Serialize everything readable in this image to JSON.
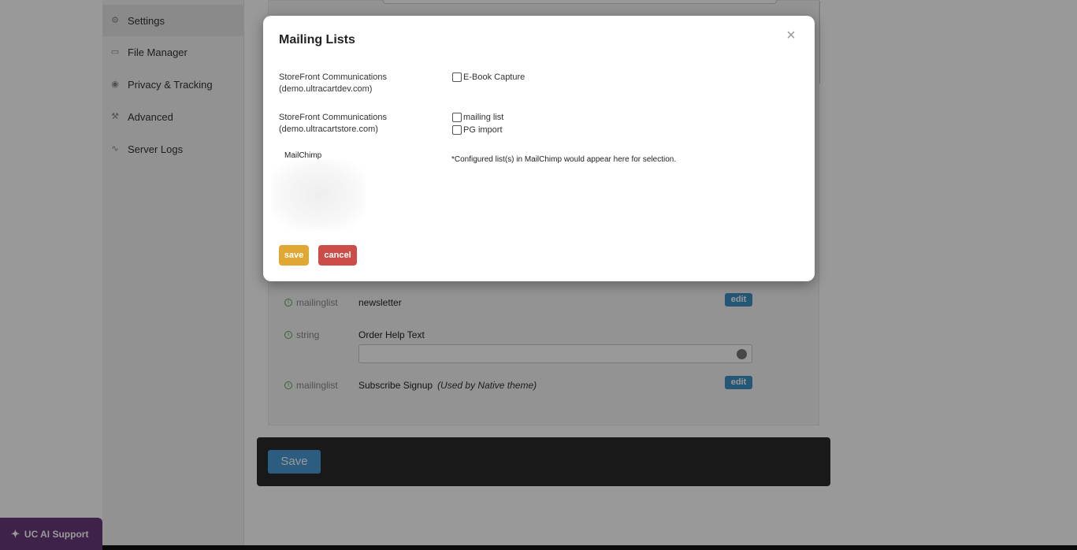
{
  "sidebar": {
    "items": [
      {
        "label": "Settings",
        "icon": "gear-icon",
        "active": true
      },
      {
        "label": "File Manager",
        "icon": "folder-icon",
        "active": false
      },
      {
        "label": "Privacy & Tracking",
        "icon": "eye-icon",
        "active": false
      },
      {
        "label": "Advanced",
        "icon": "wrench-icon",
        "active": false
      },
      {
        "label": "Server Logs",
        "icon": "pulse-icon",
        "active": false
      }
    ]
  },
  "main": {
    "rows": [
      {
        "type": "mailinglist",
        "label": "newsletter",
        "note": "",
        "edit": "edit"
      },
      {
        "type": "string",
        "label": "Order Help Text",
        "note": "",
        "edit": ""
      },
      {
        "type": "mailinglist",
        "label": "Subscribe Signup",
        "note": "(Used by Native theme)",
        "edit": "edit"
      }
    ],
    "save_label": "Save"
  },
  "ai_support": {
    "label": "UC AI Support"
  },
  "modal": {
    "title": "Mailing Lists",
    "close_icon": "×",
    "providers": [
      {
        "name": "StoreFront Communications",
        "domain": "(demo.ultracartdev.com)",
        "lists": [
          "E-Book Capture"
        ]
      },
      {
        "name": "StoreFront Communications",
        "domain": "(demo.ultracartstore.com)",
        "lists": [
          "mailing list",
          "PG import"
        ]
      }
    ],
    "mailchimp": {
      "label": "MailChimp",
      "note": "*Configured list(s) in MailChimp would appear here for selection."
    },
    "save_label": "save",
    "cancel_label": "cancel"
  },
  "colors": {
    "accent_edit": "#3d8fc4",
    "save_yellow": "#e0a832",
    "cancel_red": "#cc4c48",
    "ai_purple": "#6a3a7a"
  }
}
